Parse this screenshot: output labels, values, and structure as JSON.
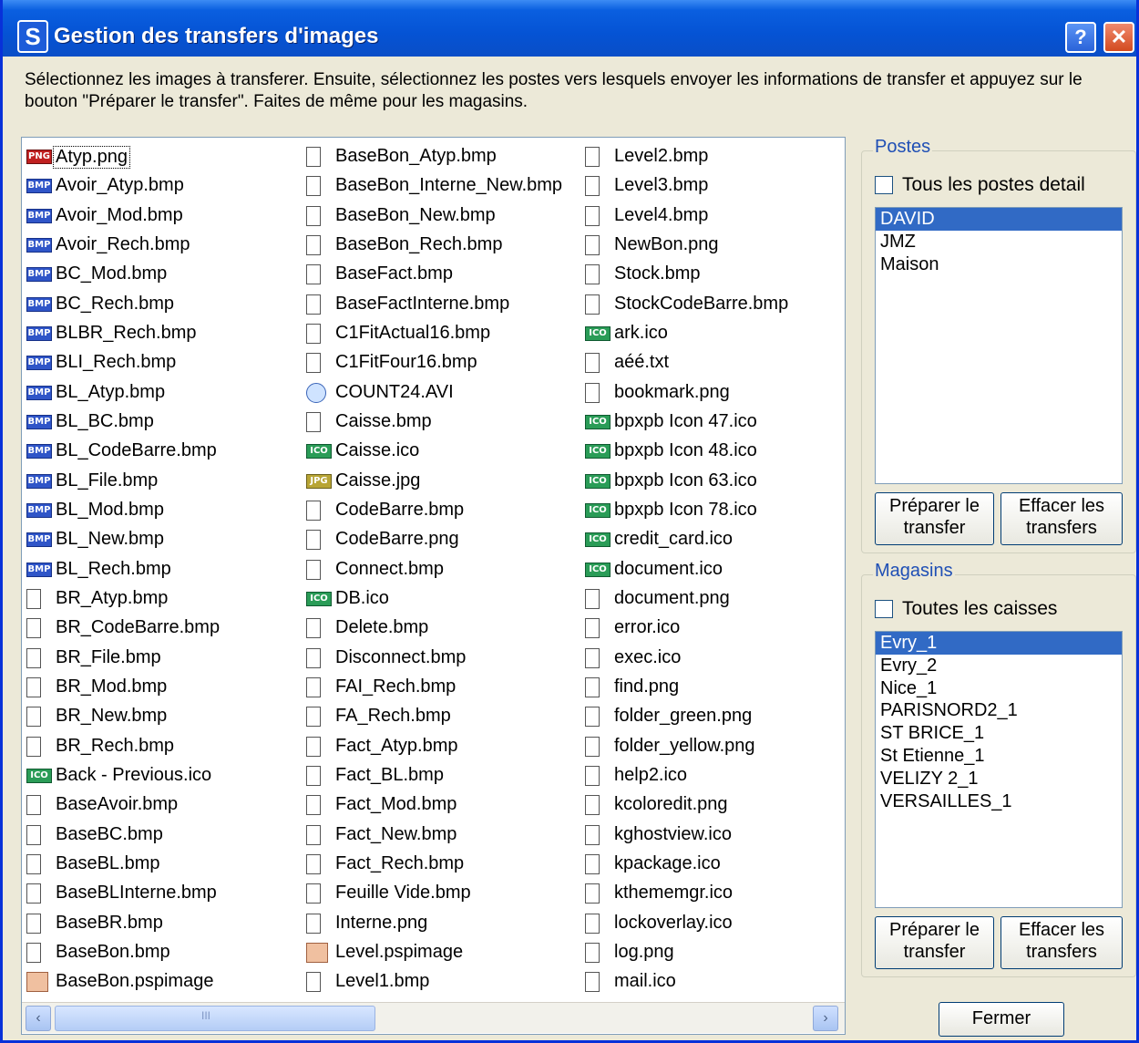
{
  "window": {
    "title": "Gestion des transfers d'images",
    "app_icon": "S",
    "help_label": "?",
    "close_label": "✕"
  },
  "instructions": "Sélectionnez les images à transferer.  Ensuite, sélectionnez les postes vers lesquels envoyer les informations de transfer et appuyez sur le bouton \"Préparer le transfer\". Faites de même pour les magasins.",
  "files": {
    "columns": [
      [
        {
          "name": "Atyp.png",
          "icon": "png",
          "focused": true
        },
        {
          "name": "Avoir_Atyp.bmp",
          "icon": "bmp"
        },
        {
          "name": "Avoir_Mod.bmp",
          "icon": "bmp"
        },
        {
          "name": "Avoir_Rech.bmp",
          "icon": "bmp"
        },
        {
          "name": "BC_Mod.bmp",
          "icon": "bmp"
        },
        {
          "name": "BC_Rech.bmp",
          "icon": "bmp"
        },
        {
          "name": "BLBR_Rech.bmp",
          "icon": "bmp"
        },
        {
          "name": "BLI_Rech.bmp",
          "icon": "bmp"
        },
        {
          "name": "BL_Atyp.bmp",
          "icon": "bmp"
        },
        {
          "name": "BL_BC.bmp",
          "icon": "bmp"
        },
        {
          "name": "BL_CodeBarre.bmp",
          "icon": "bmp"
        },
        {
          "name": "BL_File.bmp",
          "icon": "bmp"
        },
        {
          "name": "BL_Mod.bmp",
          "icon": "bmp"
        },
        {
          "name": "BL_New.bmp",
          "icon": "bmp"
        },
        {
          "name": "BL_Rech.bmp",
          "icon": "bmp"
        },
        {
          "name": "BR_Atyp.bmp",
          "icon": "doc"
        },
        {
          "name": "BR_CodeBarre.bmp",
          "icon": "doc"
        },
        {
          "name": "BR_File.bmp",
          "icon": "doc"
        },
        {
          "name": "BR_Mod.bmp",
          "icon": "doc"
        },
        {
          "name": "BR_New.bmp",
          "icon": "doc"
        },
        {
          "name": "BR_Rech.bmp",
          "icon": "doc"
        },
        {
          "name": "Back - Previous.ico",
          "icon": "ico"
        },
        {
          "name": "BaseAvoir.bmp",
          "icon": "doc"
        },
        {
          "name": "BaseBC.bmp",
          "icon": "doc"
        },
        {
          "name": "BaseBL.bmp",
          "icon": "doc"
        },
        {
          "name": "BaseBLInterne.bmp",
          "icon": "doc"
        },
        {
          "name": "BaseBR.bmp",
          "icon": "doc"
        },
        {
          "name": "BaseBon.bmp",
          "icon": "doc"
        },
        {
          "name": "BaseBon.pspimage",
          "icon": "psp"
        }
      ],
      [
        {
          "name": "BaseBon_Atyp.bmp",
          "icon": "doc"
        },
        {
          "name": "BaseBon_Interne_New.bmp",
          "icon": "doc"
        },
        {
          "name": "BaseBon_New.bmp",
          "icon": "doc"
        },
        {
          "name": "BaseBon_Rech.bmp",
          "icon": "doc"
        },
        {
          "name": "BaseFact.bmp",
          "icon": "doc"
        },
        {
          "name": "BaseFactInterne.bmp",
          "icon": "doc"
        },
        {
          "name": "C1FitActual16.bmp",
          "icon": "doc"
        },
        {
          "name": "C1FitFour16.bmp",
          "icon": "doc"
        },
        {
          "name": "COUNT24.AVI",
          "icon": "avi"
        },
        {
          "name": "Caisse.bmp",
          "icon": "doc"
        },
        {
          "name": "Caisse.ico",
          "icon": "ico"
        },
        {
          "name": "Caisse.jpg",
          "icon": "jpg"
        },
        {
          "name": "CodeBarre.bmp",
          "icon": "doc"
        },
        {
          "name": "CodeBarre.png",
          "icon": "doc"
        },
        {
          "name": "Connect.bmp",
          "icon": "doc"
        },
        {
          "name": "DB.ico",
          "icon": "ico"
        },
        {
          "name": "Delete.bmp",
          "icon": "doc"
        },
        {
          "name": "Disconnect.bmp",
          "icon": "doc"
        },
        {
          "name": "FAI_Rech.bmp",
          "icon": "doc"
        },
        {
          "name": "FA_Rech.bmp",
          "icon": "doc"
        },
        {
          "name": "Fact_Atyp.bmp",
          "icon": "doc"
        },
        {
          "name": "Fact_BL.bmp",
          "icon": "doc"
        },
        {
          "name": "Fact_Mod.bmp",
          "icon": "doc"
        },
        {
          "name": "Fact_New.bmp",
          "icon": "doc"
        },
        {
          "name": "Fact_Rech.bmp",
          "icon": "doc"
        },
        {
          "name": "Feuille Vide.bmp",
          "icon": "doc"
        },
        {
          "name": "Interne.png",
          "icon": "doc"
        },
        {
          "name": "Level.pspimage",
          "icon": "psp"
        },
        {
          "name": "Level1.bmp",
          "icon": "doc"
        }
      ],
      [
        {
          "name": "Level2.bmp",
          "icon": "doc"
        },
        {
          "name": "Level3.bmp",
          "icon": "doc"
        },
        {
          "name": "Level4.bmp",
          "icon": "doc"
        },
        {
          "name": "NewBon.png",
          "icon": "doc"
        },
        {
          "name": "Stock.bmp",
          "icon": "doc"
        },
        {
          "name": "StockCodeBarre.bmp",
          "icon": "doc"
        },
        {
          "name": "ark.ico",
          "icon": "ico"
        },
        {
          "name": "aéé.txt",
          "icon": "doc"
        },
        {
          "name": "bookmark.png",
          "icon": "doc"
        },
        {
          "name": "bpxpb Icon 47.ico",
          "icon": "ico"
        },
        {
          "name": "bpxpb Icon 48.ico",
          "icon": "ico"
        },
        {
          "name": "bpxpb Icon 63.ico",
          "icon": "ico"
        },
        {
          "name": "bpxpb Icon 78.ico",
          "icon": "ico"
        },
        {
          "name": "credit_card.ico",
          "icon": "ico"
        },
        {
          "name": "document.ico",
          "icon": "ico"
        },
        {
          "name": "document.png",
          "icon": "doc"
        },
        {
          "name": "error.ico",
          "icon": "doc"
        },
        {
          "name": "exec.ico",
          "icon": "doc"
        },
        {
          "name": "find.png",
          "icon": "doc"
        },
        {
          "name": "folder_green.png",
          "icon": "doc"
        },
        {
          "name": "folder_yellow.png",
          "icon": "doc"
        },
        {
          "name": "help2.ico",
          "icon": "doc"
        },
        {
          "name": "kcoloredit.png",
          "icon": "doc"
        },
        {
          "name": "kghostview.ico",
          "icon": "doc"
        },
        {
          "name": "kpackage.ico",
          "icon": "doc"
        },
        {
          "name": "kthememgr.ico",
          "icon": "doc"
        },
        {
          "name": "lockoverlay.ico",
          "icon": "doc"
        },
        {
          "name": "log.png",
          "icon": "doc"
        },
        {
          "name": "mail.ico",
          "icon": "doc"
        }
      ]
    ],
    "icon_labels": {
      "bmp": "BMP",
      "ico": "ICO",
      "png": "PNG",
      "jpg": "JPG"
    }
  },
  "scrollbar": {
    "left_arrow": "‹",
    "right_arrow": "›",
    "thumb_grip": "III"
  },
  "postes": {
    "title": "Postes",
    "checkbox_label": "Tous les postes detail",
    "items": [
      "DAVID",
      "JMZ",
      "Maison"
    ],
    "selected_index": 0,
    "prepare_label_line1": "Préparer le",
    "prepare_label_line2": "transfer",
    "clear_label_line1": "Effacer les",
    "clear_label_line2": "transfers"
  },
  "magasins": {
    "title": "Magasins",
    "checkbox_label": "Toutes les caisses",
    "items": [
      "Evry_1",
      "Evry_2",
      "Nice_1",
      "PARISNORD2_1",
      "ST BRICE_1",
      "St Etienne_1",
      "VELIZY 2_1",
      "VERSAILLES_1"
    ],
    "selected_index": 0,
    "prepare_label_line1": "Préparer le",
    "prepare_label_line2": "transfer",
    "clear_label_line1": "Effacer les",
    "clear_label_line2": "transfers"
  },
  "close_button_label": "Fermer",
  "colors": {
    "title_bar": "#0553d4",
    "selection": "#316ac5",
    "group_title": "#1f4fb5",
    "dialog_bg": "#ece9d8"
  }
}
